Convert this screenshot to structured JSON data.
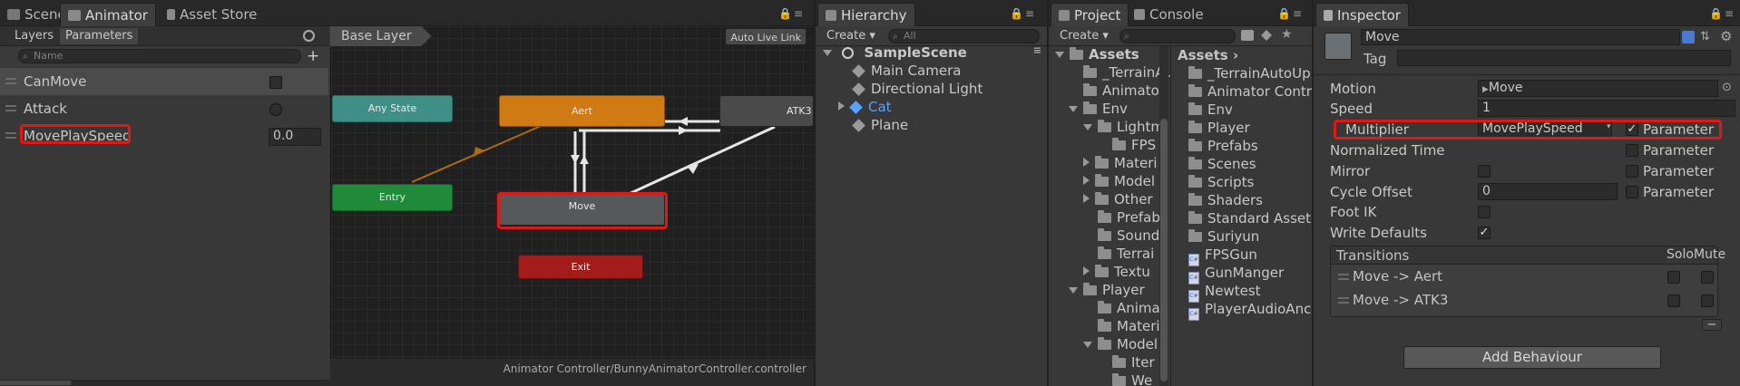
{
  "animator": {
    "tabs": [
      "Scene",
      "Animator",
      "Asset Store"
    ],
    "sub_tabs": [
      "Layers",
      "Parameters"
    ],
    "search_placeholder": "Name",
    "params": [
      {
        "name": "CanMove",
        "type": "bool",
        "value": ""
      },
      {
        "name": "Attack",
        "type": "trigger",
        "value": ""
      },
      {
        "name": "MovePlaySpeed",
        "type": "float",
        "value": "0.0"
      }
    ],
    "layer": "Base Layer",
    "auto_live_link": "Auto Live Link",
    "nodes": {
      "any_state": "Any State",
      "entry": "Entry",
      "aert": "Aert",
      "atk3": "ATK3",
      "move": "Move",
      "exit": "Exit"
    },
    "path": "Animator Controller/BunnyAnimatorController.controller"
  },
  "hierarchy": {
    "tab": "Hierarchy",
    "create": "Create",
    "search": "All",
    "scene": "SampleScene",
    "items": [
      "Main Camera",
      "Directional Light",
      "Cat",
      "Plane"
    ]
  },
  "project": {
    "tabs": [
      "Project",
      "Console"
    ],
    "create": "Create",
    "tree": [
      "Assets",
      "_TerrainAuto",
      "Animator",
      "Env",
      "Lightm",
      "FPS",
      "Materi",
      "Model",
      "Other",
      "Prefab",
      "Sound",
      "Terrai",
      "Textu",
      "Player",
      "Anima",
      "Materi",
      "Model",
      "Iter",
      "We"
    ],
    "breadcrumb": "Assets",
    "assets": [
      "_TerrainAutoUp",
      "Animator Contr",
      "Env",
      "Player",
      "Prefabs",
      "Scenes",
      "Scripts",
      "Shaders",
      "Standard Asset",
      "Suriyun",
      "FPSGun",
      "GunManger",
      "Newtest",
      "PlayerAudioAnc"
    ]
  },
  "inspector": {
    "tab": "Inspector",
    "name": "Move",
    "tag_label": "Tag",
    "motion_label": "Motion",
    "motion_value": "Move",
    "speed_label": "Speed",
    "speed_value": "1",
    "multiplier_label": "Multiplier",
    "multiplier_value": "MovePlaySpeed",
    "parameter_label": "Parameter",
    "normalized_time_label": "Normalized Time",
    "mirror_label": "Mirror",
    "cycle_offset_label": "Cycle Offset",
    "cycle_offset_value": "0",
    "foot_ik_label": "Foot IK",
    "write_defaults_label": "Write Defaults",
    "transitions_header": "Transitions",
    "solo_label": "Solo",
    "mute_label": "Mute",
    "transitions": [
      "Move -> Aert",
      "Move -> ATK3"
    ],
    "add_behaviour": "Add Behaviour",
    "checkmark": "✓",
    "minus": "−"
  },
  "colors": {
    "accent_red": "#e01818",
    "aert_orange": "#d07a14",
    "entry_green": "#1e8a3a",
    "exit_red": "#a31c1c",
    "any_state_teal": "#3f8f87"
  }
}
